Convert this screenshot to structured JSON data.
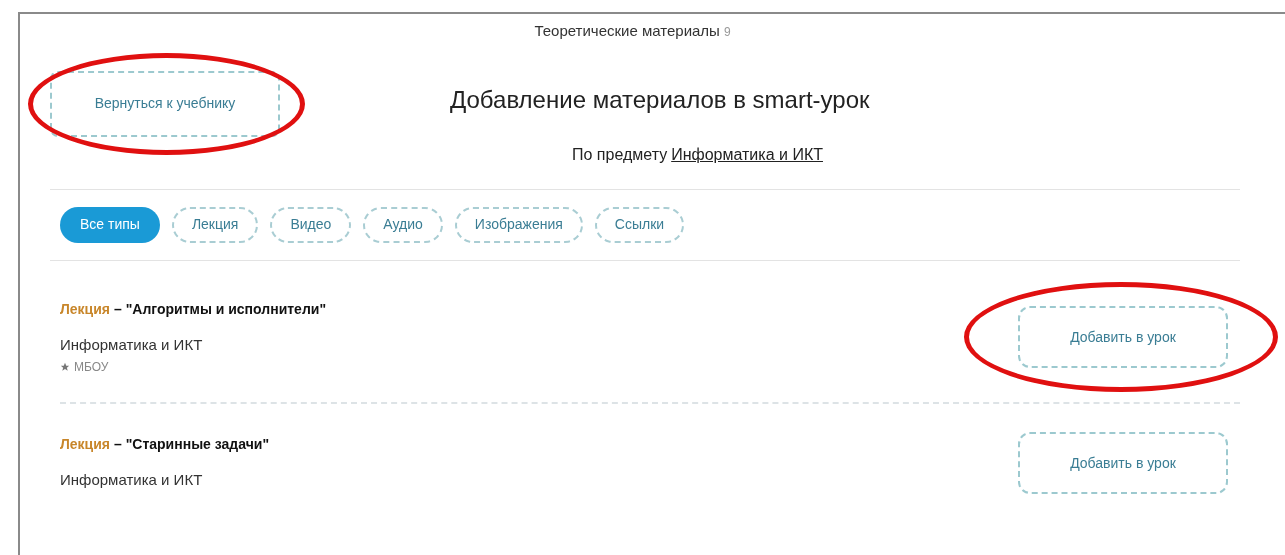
{
  "header": {
    "title": "Теоретические материалы",
    "count": "9"
  },
  "back_button": {
    "label": "Вернуться к учебнику",
    "circled": true
  },
  "heading": "Добавление материалов в smart-урок",
  "subject_line": {
    "prefix": "По предмету",
    "link": "Информатика и ИКТ"
  },
  "filters": [
    {
      "label": "Все типы",
      "selected": true
    },
    {
      "label": "Лекция",
      "selected": false
    },
    {
      "label": "Видео",
      "selected": false
    },
    {
      "label": "Аудио",
      "selected": false
    },
    {
      "label": "Изображения",
      "selected": false
    },
    {
      "label": "Ссылки",
      "selected": false
    }
  ],
  "materials": [
    {
      "type": "Лекция",
      "title": "– \"Алгоритмы и исполнители\"",
      "subject": "Информатика и ИКТ",
      "author": "МБОУ",
      "button": "Добавить в урок",
      "circled": true
    },
    {
      "type": "Лекция",
      "title": "– \"Старинные задачи\"",
      "subject": "Информатика и ИКТ",
      "button": "Добавить в урок",
      "circled": false
    }
  ]
}
